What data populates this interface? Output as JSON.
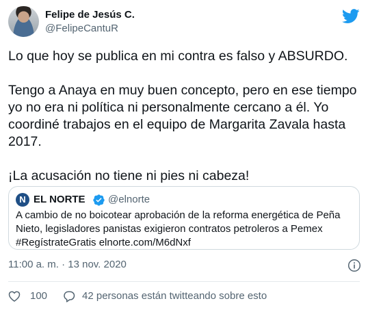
{
  "author": {
    "name": "Felipe de Jesús C.",
    "handle": "@FelipeCantuR"
  },
  "tweet": {
    "paragraphs": [
      "Lo que hoy se publica en mi contra es falso y ABSURDO.",
      "Tengo a Anaya en muy buen concepto, pero en ese tiempo yo no era ni política ni personalmente cercano a él. Yo coordiné trabajos en el equipo de Margarita Zavala hasta 2017.",
      "¡La acusación no tiene ni pies ni cabeza!"
    ]
  },
  "quote": {
    "logo_letter": "N",
    "name": "EL NORTE",
    "handle": "@elnorte",
    "text": "A cambio de no boicotear aprobación de la reforma energética de Peña Nieto, legisladores panistas exigieron contratos petroleros a Pemex #RegístrateGratis elnorte.com/M6dNxf"
  },
  "meta": {
    "timestamp": "11:00 a. m. · 13 nov. 2020"
  },
  "actions": {
    "like_count": "100",
    "conversation_text": "42 personas están twitteando sobre esto"
  },
  "colors": {
    "twitter_blue": "#1d9bf0",
    "text": "#0f1419",
    "muted": "#536471",
    "border": "#cfd9de"
  },
  "icons": [
    "twitter-bird-icon",
    "verified-badge-icon",
    "info-icon",
    "heart-icon",
    "reply-bubble-icon"
  ]
}
